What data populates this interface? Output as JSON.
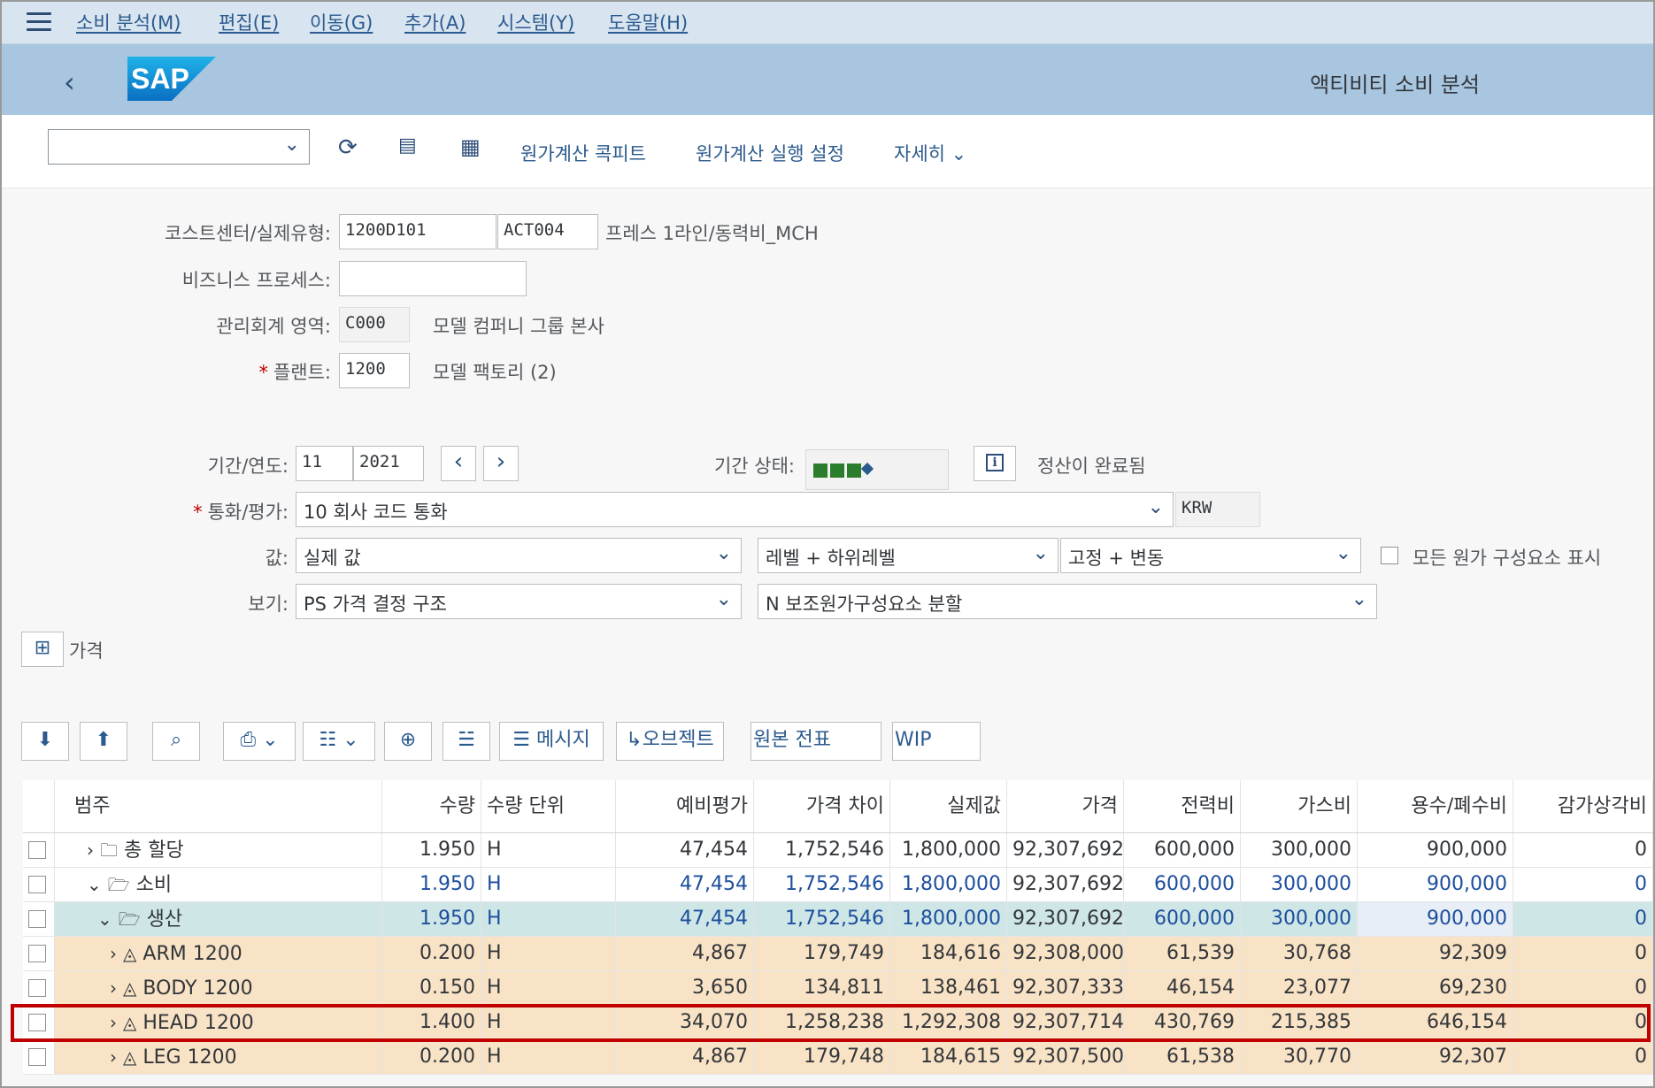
{
  "menubar": {
    "items": [
      "소비 분석(M)",
      "편집(E)",
      "이동(G)",
      "추가(A)",
      "시스템(Y)",
      "도움말(H)"
    ]
  },
  "shell": {
    "title": "액티비티 소비 분석",
    "logo_text": "SAP"
  },
  "toolbar": {
    "cockpit": "원가계산 콕피트",
    "run_settings": "원가계산 실행 설정",
    "more": "자세히"
  },
  "form": {
    "cost_center_label": "코스트센터/실제유형:",
    "cost_center": "1200D101",
    "activity_type": "ACT004",
    "cost_center_desc": "프레스 1라인/동력비_MCH",
    "business_process_label": "비즈니스 프로세스:",
    "controlling_area_label": "관리회계 영역:",
    "controlling_area": "C000",
    "controlling_area_desc": "모델 컴퍼니 그룹 본사",
    "plant_label": "플랜트:",
    "plant": "1200",
    "plant_desc": "모델 팩토리 (2)",
    "period_label": "기간/연도:",
    "period": "11",
    "year": "2021",
    "period_status_label": "기간 상태:",
    "period_status_text": "정산이 완료됨",
    "currency_label": "통화/평가:",
    "currency_value": "10 회사 코드 통화",
    "currency_code": "KRW",
    "value_label": "값:",
    "value_select": "실제 값",
    "level_select": "레벨 + 하위레벨",
    "fixed_select": "고정 + 변동",
    "all_components_label": "모든 원가 구성요소 표시",
    "view_label": "보기:",
    "view_select": "PS 가격 결정 구조",
    "split_select": "N 보조원가구성요소 분할",
    "price_label": "가격"
  },
  "alv_toolbar": {
    "message": "메시지",
    "object": "오브젝트",
    "source_doc": "원본 전표",
    "wip": "WIP"
  },
  "table": {
    "headers": [
      "범주",
      "수량",
      "수량 단위",
      "예비평가",
      "가격 차이",
      "실제값",
      "가격",
      "전력비",
      "가스비",
      "용수/폐수비",
      "감가상각비"
    ],
    "rows": [
      {
        "cat": "총 할당",
        "qty": "1.950",
        "unit": "H",
        "prelim": "47,454",
        "diff": "1,752,546",
        "actual": "1,800,000",
        "price": "92,307,692",
        "power": "600,000",
        "gas": "300,000",
        "water": "900,000",
        "depr": "0"
      },
      {
        "cat": "소비",
        "qty": "1.950",
        "unit": "H",
        "prelim": "47,454",
        "diff": "1,752,546",
        "actual": "1,800,000",
        "price": "92,307,692",
        "power": "600,000",
        "gas": "300,000",
        "water": "900,000",
        "depr": "0"
      },
      {
        "cat": "생산",
        "qty": "1.950",
        "unit": "H",
        "prelim": "47,454",
        "diff": "1,752,546",
        "actual": "1,800,000",
        "price": "92,307,692",
        "power": "600,000",
        "gas": "300,000",
        "water": "900,000",
        "depr": "0"
      },
      {
        "cat": "ARM 1200",
        "qty": "0.200",
        "unit": "H",
        "prelim": "4,867",
        "diff": "179,749",
        "actual": "184,616",
        "price": "92,308,000",
        "power": "61,539",
        "gas": "30,768",
        "water": "92,309",
        "depr": "0"
      },
      {
        "cat": "BODY 1200",
        "qty": "0.150",
        "unit": "H",
        "prelim": "3,650",
        "diff": "134,811",
        "actual": "138,461",
        "price": "92,307,333",
        "power": "46,154",
        "gas": "23,077",
        "water": "69,230",
        "depr": "0"
      },
      {
        "cat": "HEAD 1200",
        "qty": "1.400",
        "unit": "H",
        "prelim": "34,070",
        "diff": "1,258,238",
        "actual": "1,292,308",
        "price": "92,307,714",
        "power": "430,769",
        "gas": "215,385",
        "water": "646,154",
        "depr": "0"
      },
      {
        "cat": "LEG 1200",
        "qty": "0.200",
        "unit": "H",
        "prelim": "4,867",
        "diff": "179,748",
        "actual": "184,615",
        "price": "92,307,500",
        "power": "61,538",
        "gas": "30,770",
        "water": "92,307",
        "depr": "0"
      }
    ]
  },
  "colors": {
    "shellbar": "#a8c6e0",
    "menubar": "#d8e4ef",
    "teal_row": "#cfe6e6",
    "orange_row": "#f9e3c6",
    "highlight": "#c00000",
    "link": "#2b5a8e"
  }
}
